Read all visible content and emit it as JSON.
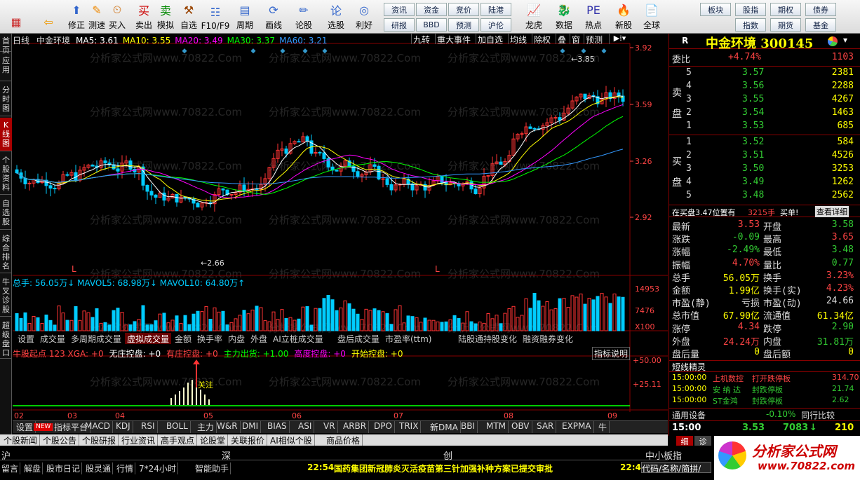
{
  "toolbar": {
    "items": [
      {
        "name": "home",
        "label": ""
      },
      {
        "name": "back",
        "label": ""
      },
      {
        "name": "fix",
        "label": "修正"
      },
      {
        "name": "backtest",
        "label": "测速"
      },
      {
        "name": "buy",
        "label": "买入"
      },
      {
        "name": "sell",
        "label": "卖出"
      },
      {
        "name": "sim",
        "label": "模拟"
      },
      {
        "name": "watch",
        "label": "自选"
      },
      {
        "name": "f10",
        "label": "F10/F9"
      },
      {
        "name": "cycle",
        "label": "周期"
      },
      {
        "name": "draw",
        "label": "画线"
      },
      {
        "name": "forum",
        "label": "论股"
      },
      {
        "name": "pick",
        "label": "选股"
      },
      {
        "name": "profit",
        "label": "利好"
      },
      {
        "name": "dragon",
        "label": "龙虎"
      },
      {
        "name": "data",
        "label": "数据"
      },
      {
        "name": "hot",
        "label": "热点"
      },
      {
        "name": "ipo",
        "label": "新股"
      },
      {
        "name": "global",
        "label": "全球"
      }
    ],
    "quick": [
      "资讯",
      "资金",
      "竞价",
      "陆港",
      "研报",
      "BBD",
      "预测",
      "沪伦",
      "板块",
      "股指",
      "期权",
      "债券",
      "指数",
      "期货",
      "基金"
    ]
  },
  "left_tabs": [
    "首页",
    "应用",
    "分时图",
    "K线图",
    "个股资料",
    "自选股",
    "综合排名",
    "牛叉诊股",
    "超级盘口"
  ],
  "chart": {
    "period": "日线",
    "name": "中金环境",
    "ma": [
      {
        "label": "MA5: 3.61",
        "color": "#fff"
      },
      {
        "label": "MA10: 3.55",
        "color": "#ff0"
      },
      {
        "label": "MA20: 3.49",
        "color": "#f0f"
      },
      {
        "label": "MA30: 3.37",
        "color": "#0f0"
      },
      {
        "label": "MA60: 3.21",
        "color": "#39f"
      }
    ],
    "buttons": [
      "九转",
      "重大事件",
      "加自选",
      "均线",
      "除权",
      "叠",
      "窗",
      "预测"
    ],
    "price_ticks": [
      "3.92",
      "3.59",
      "3.26",
      "2.92"
    ],
    "hi": "3.85",
    "lo": "2.66",
    "marks": [
      "L",
      "L"
    ],
    "vol_line": "总手: 56.05万↓  MAVOL5: 68.98万↓  MAVOL10: 64.80万↑",
    "vol_ticks": [
      "14953",
      "7476",
      "X100"
    ],
    "tabs": [
      "设置",
      "成交量",
      "多周期成交量",
      "虚拟成交量",
      "金额",
      "换手率",
      "内盘",
      "外盘",
      "AI立桩成交量",
      "盘后成交量",
      "市盈率(ttm)",
      "陆股通持股变化",
      "融资融券变化"
    ],
    "ind_line": [
      {
        "t": "牛股起点 123 XGA: +0",
        "c": "#f44"
      },
      {
        "t": "无庄控盘: +0",
        "c": "#fff"
      },
      {
        "t": "有庄控盘: +0",
        "c": "#f44"
      },
      {
        "t": "主力出货: +1.00",
        "c": "#0f0"
      },
      {
        "t": "高度控盘: +0",
        "c": "#f0f"
      },
      {
        "t": "开始控盘: +0",
        "c": "#ff0"
      }
    ],
    "ind_button": "指标说明",
    "ind_ticks": [
      "+50.00",
      "+25.11"
    ],
    "ind_note": "关注",
    "months": [
      "02",
      "03",
      "04",
      "05",
      "06",
      "07",
      "08",
      "09"
    ],
    "watermark": "分析家公式网www.70822.Com"
  },
  "ind_tabs": [
    "设置",
    "NEW",
    "指标平台",
    "MACD",
    "KDJ",
    "RSI",
    "BOLL",
    "主力",
    "W&R",
    "DMI",
    "BIAS",
    "ASI",
    "VR",
    "ARBR",
    "DPO",
    "TRIX",
    "新DMA",
    "BBI",
    "MTM",
    "OBV",
    "SAR",
    "EXPMA",
    "牛"
  ],
  "bottom_tabs": [
    "个股新闻",
    "个股公告",
    "个股研报",
    "行业资讯",
    "高手观点",
    "论股堂",
    "关联报价",
    "AI相似个股",
    "商品价格"
  ],
  "right": {
    "flag": "R",
    "title": "中金环境 300145",
    "webi": "委比",
    "webi_val": "+4.74%",
    "webi_n": "1103",
    "sell": [
      {
        "n": "5",
        "p": "3.57",
        "v": "2381"
      },
      {
        "n": "4",
        "p": "3.56",
        "v": "2288"
      },
      {
        "n": "3",
        "p": "3.55",
        "v": "4267"
      },
      {
        "n": "2",
        "p": "3.54",
        "v": "1463"
      },
      {
        "n": "1",
        "p": "3.53",
        "v": "685"
      }
    ],
    "buy": [
      {
        "n": "1",
        "p": "3.52",
        "v": "584"
      },
      {
        "n": "2",
        "p": "3.51",
        "v": "4526"
      },
      {
        "n": "3",
        "p": "3.50",
        "v": "3253"
      },
      {
        "n": "4",
        "p": "3.49",
        "v": "1262"
      },
      {
        "n": "5",
        "p": "3.48",
        "v": "2562"
      }
    ],
    "sell_label": "卖盘",
    "buy_label": "买盘",
    "notice": "在买盘3.47位置有",
    "notice_v": "3215手",
    "notice_b": "买单!",
    "notice_btn": "查看详细",
    "quotes": [
      [
        "最新",
        "3.53",
        "开盘",
        "3.58"
      ],
      [
        "涨跌",
        "-0.09",
        "最高",
        "3.65"
      ],
      [
        "涨幅",
        "-2.49%",
        "最低",
        "3.48"
      ],
      [
        "振幅",
        "4.70%",
        "量比",
        "0.77"
      ],
      [
        "总手",
        "56.05万",
        "换手",
        "3.23%"
      ],
      [
        "金额",
        "1.99亿",
        "换手(实)",
        "4.23%"
      ],
      [
        "市盈(静)",
        "亏损",
        "市盈(动)",
        "24.66"
      ],
      [
        "总市值",
        "67.90亿",
        "流通值",
        "61.34亿"
      ],
      [
        "涨停",
        "4.34",
        "跌停",
        "2.90"
      ],
      [
        "外盘",
        "24.24万",
        "内盘",
        "31.81万"
      ],
      [
        "盘后量",
        "0",
        "盘后额",
        "0"
      ]
    ],
    "short_title": "短线精灵",
    "short": [
      [
        "15:00:00",
        "上机数控",
        "打开跌停板",
        "314.70"
      ],
      [
        "15:00:00",
        "安 纳 达",
        "封跌停板",
        "21.74"
      ],
      [
        "15:00:00",
        "ST金鸿",
        "封跌停板",
        "2.62"
      ]
    ],
    "industry": "通用设备",
    "industry_chg": "-0.10%",
    "compare": "同行比较",
    "tick_time": "15:00",
    "tick_price": "3.53",
    "tick_vol": "7083",
    "tick_n": "210",
    "side_tabs": [
      "细",
      "诊"
    ]
  },
  "status": {
    "markets": [
      "沪",
      "深",
      "创",
      "中小板指"
    ],
    "row2": [
      "留言",
      "解盘",
      "股市日记",
      "股灵通",
      "行情",
      "7*24小时",
      "智能助手"
    ],
    "news_time": "22:54",
    "news": "国药集团新冠肺炎灭活疫苗第三针加强补种方案已提交审批",
    "clock": "22:4",
    "search": "代码/名称/简拼/",
    "brand": "分析家公式网",
    "brand_url": "www.70822.com"
  }
}
